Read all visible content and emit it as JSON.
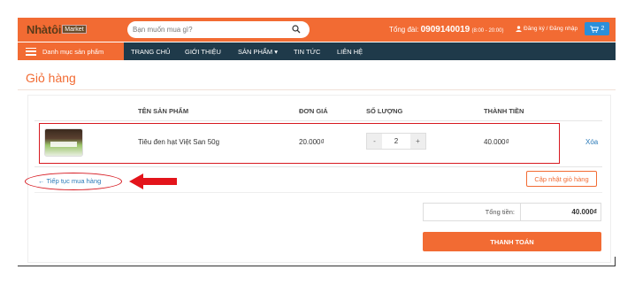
{
  "header": {
    "logo_main": "Nhàtôi",
    "logo_sub": "Market",
    "search_placeholder": "Bạn muốn mua gì?",
    "hotline_label": "Tổng đài:",
    "hotline_number": "0909140019",
    "hotline_hours": "(8:00 - 20:00)",
    "account_link": "Đăng ký / Đăng nhập",
    "cart_count": "2"
  },
  "nav": {
    "category_label": "Danh mục sản phẩm",
    "items": [
      "TRANG CHỦ",
      "GIỚI THIỆU",
      "SẢN PHẨM ▾",
      "TIN TỨC",
      "LIÊN HỆ"
    ]
  },
  "page": {
    "title": "Giỏ hàng"
  },
  "cart": {
    "columns": [
      "TÊN SẢN PHẨM",
      "ĐƠN GIÁ",
      "SỐ LƯỢNG",
      "THÀNH TIỀN"
    ],
    "rows": [
      {
        "name": "Tiêu đen hạt Việt San 50g",
        "price": "20.000₫",
        "qty": "2",
        "subtotal": "40.000₫",
        "remove": "Xóa"
      }
    ],
    "qty_minus": "-",
    "qty_plus": "+",
    "continue_label": "← Tiếp tục mua hàng",
    "update_label": "Cập nhật giỏ hàng",
    "total_label": "Tổng tiền:",
    "total_value": "40.000₫",
    "checkout_label": "THANH TOÁN"
  },
  "colors": {
    "brand_orange": "#f26b33",
    "nav_dark": "#1f3a4a",
    "link_blue": "#2a7ab8",
    "highlight_red": "#d71920"
  }
}
